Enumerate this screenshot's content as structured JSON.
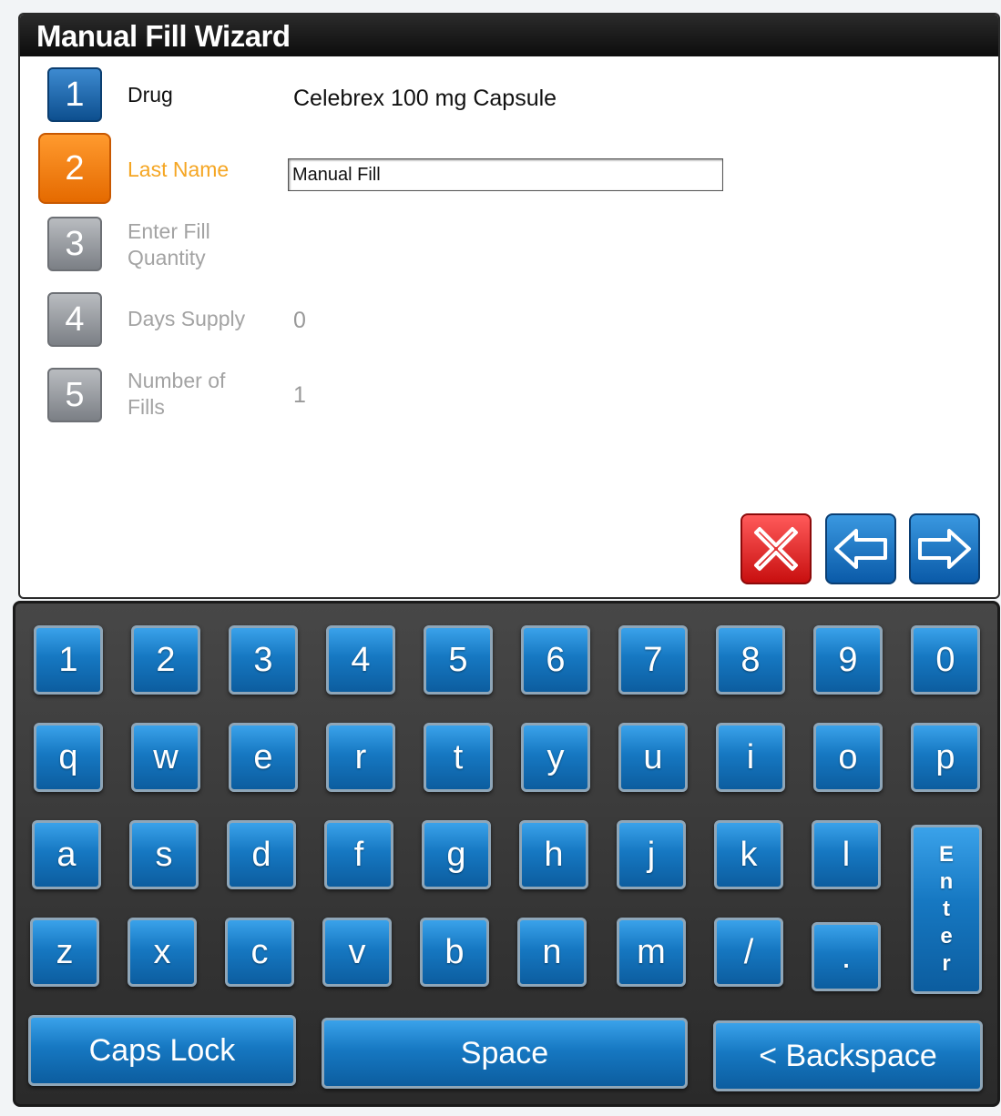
{
  "window": {
    "title": "Manual Fill Wizard"
  },
  "steps": [
    {
      "number": "1",
      "label": "Drug",
      "value": "Celebrex 100 mg Capsule"
    },
    {
      "number": "2",
      "label": "Last Name",
      "value": "Manual Fill"
    },
    {
      "number": "3",
      "label_line1": "Enter Fill",
      "label_line2": "Quantity"
    },
    {
      "number": "4",
      "label": "Days Supply",
      "value": "0"
    },
    {
      "number": "5",
      "label_line1": "Number of",
      "label_line2": "Fills",
      "value": "1"
    }
  ],
  "nav": {
    "cancel_icon": "close-icon",
    "back_icon": "arrow-left-icon",
    "next_icon": "arrow-right-icon"
  },
  "keyboard": {
    "row1": [
      "1",
      "2",
      "3",
      "4",
      "5",
      "6",
      "7",
      "8",
      "9",
      "0"
    ],
    "row2": [
      "q",
      "w",
      "e",
      "r",
      "t",
      "y",
      "u",
      "i",
      "o",
      "p"
    ],
    "row3": [
      "a",
      "s",
      "d",
      "f",
      "g",
      "h",
      "j",
      "k",
      "l"
    ],
    "row4": [
      "z",
      "x",
      "c",
      "v",
      "b",
      "n",
      "m",
      "/",
      "."
    ],
    "enter": [
      "E",
      "n",
      "t",
      "e",
      "r"
    ],
    "caps_lock": "Caps Lock",
    "space": "Space",
    "backspace": "< Backspace"
  },
  "colors": {
    "step_active": "#f58a1f",
    "key_blue": "#1678c2",
    "cancel_red": "#d9181c"
  }
}
